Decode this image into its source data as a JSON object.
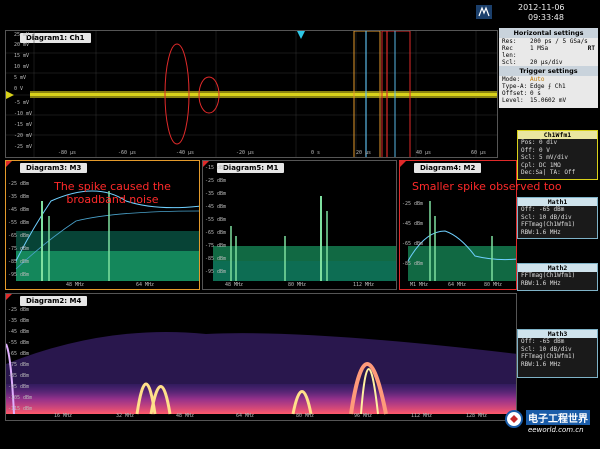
{
  "date": "2012-11-06",
  "time": "09:33:48",
  "horizontal": {
    "title": "Horizontal settings",
    "rows": [
      {
        "k": "Res:",
        "v": "200 ps / 5 GSa/s"
      },
      {
        "k": "Rec len:",
        "v": "1 MSa"
      },
      {
        "k": "Scl:",
        "v": "20 µs/div"
      }
    ],
    "rt": "RT"
  },
  "trigger": {
    "title": "Trigger settings",
    "rows": [
      {
        "k": "Mode:",
        "v": "Auto"
      },
      {
        "k": "Type-A:",
        "v": "Edge  ⨍ Ch1"
      },
      {
        "k": "Offset:",
        "v": "0 s"
      },
      {
        "k": "Level:",
        "v": "15.0602 mV"
      }
    ]
  },
  "ch1": {
    "title": "Ch1Wfm1",
    "rows": [
      "Pos: 0 div",
      "Off: 0 V",
      "Scl: 5 mV/div",
      "Cpl: DC 1MΩ",
      "Dec:Sa| TA: Off"
    ]
  },
  "maths": [
    {
      "title": "Math1",
      "rows": [
        "Off:  -65 dBm",
        "Scl:  10 dB/div",
        "FFTmag(Ch1Wfm1)",
        "RBW:1.6 MHz"
      ]
    },
    {
      "title": "Math2",
      "rows": [
        "FFTmag(Ch1Wfm1)",
        "RBW:1.6 MHz"
      ]
    },
    {
      "title": "Math3",
      "rows": [
        "Off:  -65 dBm",
        "Scl:  10 dB/div",
        "FFTmag(Ch1Wfm1)",
        "RBW:1.6 MHz"
      ]
    }
  ],
  "diagrams": {
    "d1": {
      "title": "Diagram1: Ch1",
      "yticks": [
        "25 mV",
        "20 mV",
        "15 mV",
        "10 mV",
        "5 mV",
        "0 V",
        "-5 mV",
        "-10 mV",
        "-15 mV",
        "-20 mV",
        "-25 mV"
      ],
      "xticks": [
        "-80 µs",
        "-60 µs",
        "-40 µs",
        "-20 µs",
        "0 s",
        "20 µs",
        "40 µs",
        "60 µs"
      ]
    },
    "d3": {
      "title": "Diagram3: M3",
      "yticks": [
        "-25 dBm",
        "-35 dBm",
        "-45 dBm",
        "-55 dBm",
        "-65 dBm",
        "-75 dBm",
        "-85 dBm",
        "-95 dBm"
      ],
      "xticks": [
        "48 MHz",
        "64 MHz"
      ]
    },
    "d5": {
      "title": "Diagram5: M1",
      "yticks": [
        "-15 dBm",
        "-25 dBm",
        "-35 dBm",
        "-45 dBm",
        "-55 dBm",
        "-65 dBm",
        "-75 dBm",
        "-85 dBm",
        "-95 dBm"
      ],
      "xticks": [
        "48 MHz",
        "80 MHz",
        "112 MHz"
      ]
    },
    "d4": {
      "title": "Diagram4: M2",
      "yticks": [
        "-25 dBm",
        "-45 dBm",
        "-65 dBm",
        "-85 dBm"
      ],
      "xticks": [
        "M1 MHz",
        "64 MHz",
        "80 MHz"
      ]
    },
    "d2": {
      "title": "Diagram2: M4",
      "yticks": [
        "-25 dBm",
        "-35 dBm",
        "-45 dBm",
        "-55 dBm",
        "-65 dBm",
        "-75 dBm",
        "-85 dBm",
        "-95 dBm",
        "-105 dBm",
        "-115 dBm"
      ],
      "xticks": [
        "16 MHz",
        "32 MHz",
        "48 MHz",
        "64 MHz",
        "80 MHz",
        "96 MHz",
        "112 MHz",
        "128 MHz"
      ]
    }
  },
  "annotations": {
    "left": "The spike caused the\nbroadband noise",
    "right": "Smaller spike observed too"
  },
  "watermark": {
    "cn": "电子工程世界",
    "en": "eeworld.com.cn"
  },
  "colors": {
    "ch1": "#d9d21a",
    "spectrum": "#6fd0ff",
    "persist": "#b0389a",
    "annot": "#ff2a2a"
  }
}
